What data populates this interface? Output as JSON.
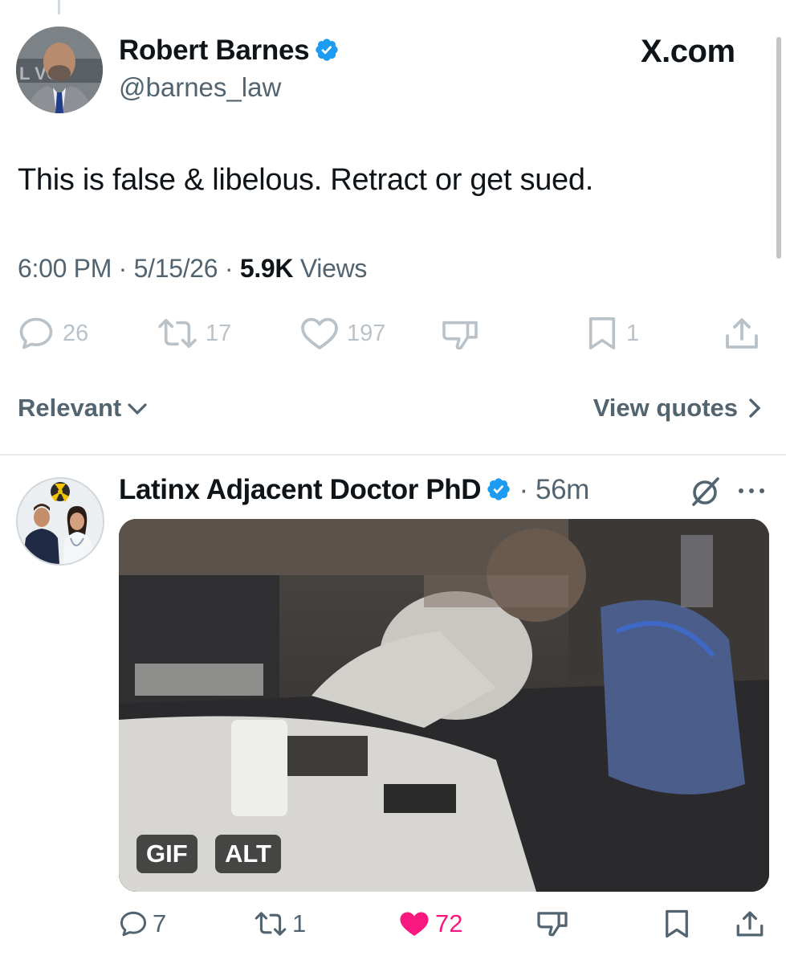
{
  "main_tweet": {
    "author_name": "Robert Barnes",
    "handle": "@barnes_law",
    "brand": "X.com",
    "text": "This is false & libelous. Retract or get sued.",
    "time": "6:00 PM",
    "date": "5/15/26",
    "views_count": "5.9K",
    "views_label": "Views",
    "actions": {
      "replies": "26",
      "reposts": "17",
      "likes": "197",
      "bookmarks": "1"
    }
  },
  "filter": {
    "sort_label": "Relevant",
    "quotes_label": "View quotes"
  },
  "reply": {
    "author_name": "Latinx Adjacent Doctor PhD",
    "time": "56m",
    "media_badges": {
      "gif": "GIF",
      "alt": "ALT"
    },
    "actions": {
      "replies": "7",
      "reposts": "1",
      "likes": "72"
    }
  },
  "colors": {
    "text_primary": "#0f1419",
    "text_secondary": "#536471",
    "verified_blue": "#1d9bf0",
    "like_pink": "#f91880",
    "divider": "#e6ecf0"
  },
  "icons": [
    "verified-badge-icon",
    "reply-icon",
    "repost-icon",
    "like-icon",
    "dislike-icon",
    "bookmark-icon",
    "share-icon",
    "chevron-down-icon",
    "chevron-right-icon",
    "grok-icon",
    "more-icon"
  ]
}
